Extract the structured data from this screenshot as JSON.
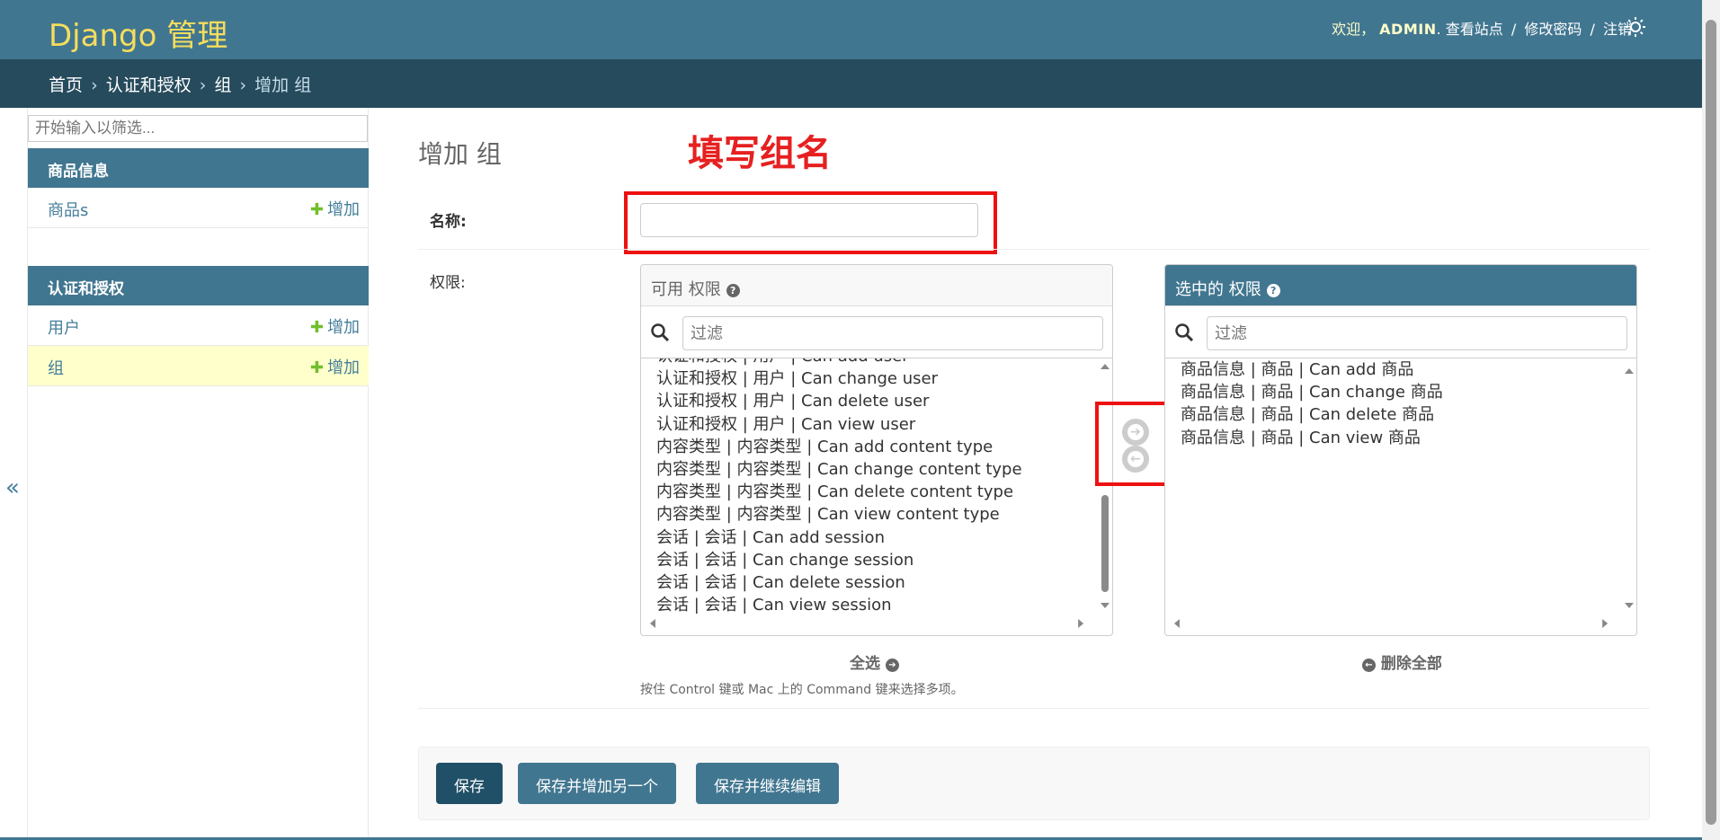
{
  "header": {
    "site_name": "Django 管理",
    "welcome": "欢迎，",
    "username": "ADMIN",
    "view_site": "查看站点",
    "change_password": "修改密码",
    "logout": "注销",
    "sep": "/",
    "theme_icon": "sun-icon"
  },
  "breadcrumbs": {
    "home": "首页",
    "app": "认证和授权",
    "model": "组",
    "current": "增加 组",
    "sep": "›"
  },
  "sidebar": {
    "filter_placeholder": "开始输入以筛选...",
    "apps": [
      {
        "caption": "商品信息",
        "models": [
          {
            "name": "商品s",
            "add": "增加"
          }
        ]
      },
      {
        "caption": "认证和授权",
        "models": [
          {
            "name": "用户",
            "add": "增加"
          },
          {
            "name": "组",
            "add": "增加"
          }
        ]
      }
    ],
    "toggle": "«"
  },
  "content": {
    "title": "增加 组",
    "annotation": "填写组名",
    "name_label": "名称:",
    "name_value": "",
    "permissions_label": "权限:"
  },
  "selector": {
    "available_title": "可用 权限",
    "chosen_title": "选中的 权限",
    "help": "?",
    "filter_placeholder": "过滤",
    "available_options": [
      "认证和授权 | 用户 | Can add user",
      "认证和授权 | 用户 | Can change user",
      "认证和授权 | 用户 | Can delete user",
      "认证和授权 | 用户 | Can view user",
      "内容类型 | 内容类型 | Can add content type",
      "内容类型 | 内容类型 | Can change content type",
      "内容类型 | 内容类型 | Can delete content type",
      "内容类型 | 内容类型 | Can view content type",
      "会话 | 会话 | Can add session",
      "会话 | 会话 | Can change session",
      "会话 | 会话 | Can delete session",
      "会话 | 会话 | Can view session"
    ],
    "chosen_options": [
      "商品信息 | 商品 | Can add 商品",
      "商品信息 | 商品 | Can change 商品",
      "商品信息 | 商品 | Can delete 商品",
      "商品信息 | 商品 | Can view 商品"
    ],
    "choose_all": "全选",
    "remove_all": "删除全部",
    "help_text": "按住 Control 键或 Mac 上的 Command 键来选择多项。"
  },
  "submit": {
    "save": "保存",
    "save_add_another": "保存并增加另一个",
    "save_continue": "保存并继续编辑"
  },
  "colors": {
    "header": "#417690",
    "breadcrumbs": "#264b5d",
    "branding": "#f5dd5d",
    "annotation": "#e62020"
  }
}
